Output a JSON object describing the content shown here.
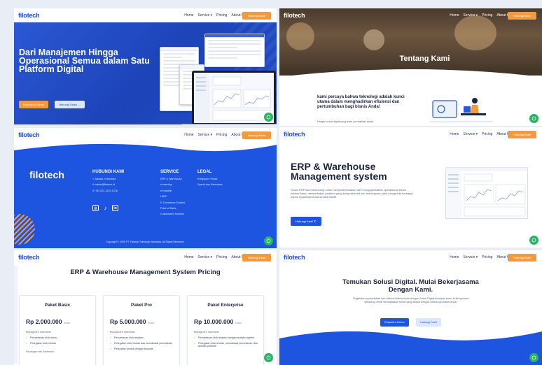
{
  "brand": {
    "logo": "filotech",
    "accent": "#1e55e0",
    "cta_color": "#f39a3c"
  },
  "nav": {
    "items": [
      "Home",
      "Service ▾",
      "Pricing",
      "About Us"
    ],
    "cta": "Hubungi Kami"
  },
  "hero": {
    "title": "Dari Manajemen Hingga Operasional Semua dalam Satu Platform Digital",
    "btn_primary": "Request a Demo",
    "btn_secondary": "Hubungi Sales →"
  },
  "about": {
    "title": "Tentang Kami",
    "text": "kami percaya bahwa teknologi adalah kunci utama dalam menghadirkan efisiensi dan pertumbuhan bagi bisnis Anda!",
    "sub": "Dengan solusi digital yang tepat, perusahaan dapat"
  },
  "footer": {
    "logo": "filotech",
    "contact": {
      "heading": "HUBUNGI KAMI",
      "items": [
        "Jakarta, Indonesia",
        "sales@filotech.id",
        "+62 821-1119-1228"
      ]
    },
    "service": {
      "heading": "SERVICE",
      "items": [
        "ERP & Warehouse",
        "eLearning",
        "e-hospital",
        "HRIS",
        "E-Commerce Enabler",
        "Point of Sales",
        "Customized Solution"
      ]
    },
    "legal": {
      "heading": "LEGAL",
      "items": [
        "Kebijakan Privasi",
        "Syarat dan Ketentuan"
      ]
    },
    "copyright": "Copyright © 2025 PT. Filotech Teknologi Indonesia. All Rights Reserved."
  },
  "erp": {
    "title": "ERP & Warehouse Management system",
    "desc": "Solusi ERP kami dirancang untuk menyederhanakan dan mengoptimalkan operasional bisnis partner kami, menyediakan platform yang komprehensif dan terintegrasi untuk mengelola berbagai aspek organisasi Anda secara efektif.",
    "btn": "Hubungi Kami"
  },
  "pricing": {
    "title": "ERP & Warehouse Management System Pricing",
    "plans": [
      {
        "name": "Paket Basic",
        "price": "Rp 2.000.000",
        "unit": "/bulan",
        "section": "Manajemen Inventaris:",
        "features": [
          "Pemantauan stok dasar",
          "Peringatan stok rendah"
        ],
        "section2": "Keuangan dan Akuntansi:"
      },
      {
        "name": "Paket Pro",
        "price": "Rp 5.000.000",
        "unit": "/bulan",
        "section": "Manajemen Inventaris:",
        "features": [
          "Pemantauan stok lanjutan",
          "Peringatan stok rendah dan otomatisasi pemesanan",
          "Pelacakan produk dengan barcode"
        ]
      },
      {
        "name": "Paket Enterprise",
        "price": "Rp 10.000.000",
        "unit": "/bulan",
        "section": "Manajemen Inventaris:",
        "features": [
          "Pemantauan stok lanjutan dengan analytic system",
          "Peringatan stok rendah, otomatisasi pemesanan, dan analisis prediktif"
        ]
      }
    ]
  },
  "cta_section": {
    "title": "Temukan Solusi Digital. Mulai Bekerjasama Dengan Kami.",
    "desc": "Tingkatkan produktivitas dan efisiensi bisnis Anda dengan Solusi Digital terdepan kami. Hubungi kami sekarang untuk mendapatkan solusi yang sesuai dengan kebutuhan bisnis Anda!",
    "btn_primary": "Request a Demo",
    "btn_secondary": "Hubungi Kami"
  }
}
